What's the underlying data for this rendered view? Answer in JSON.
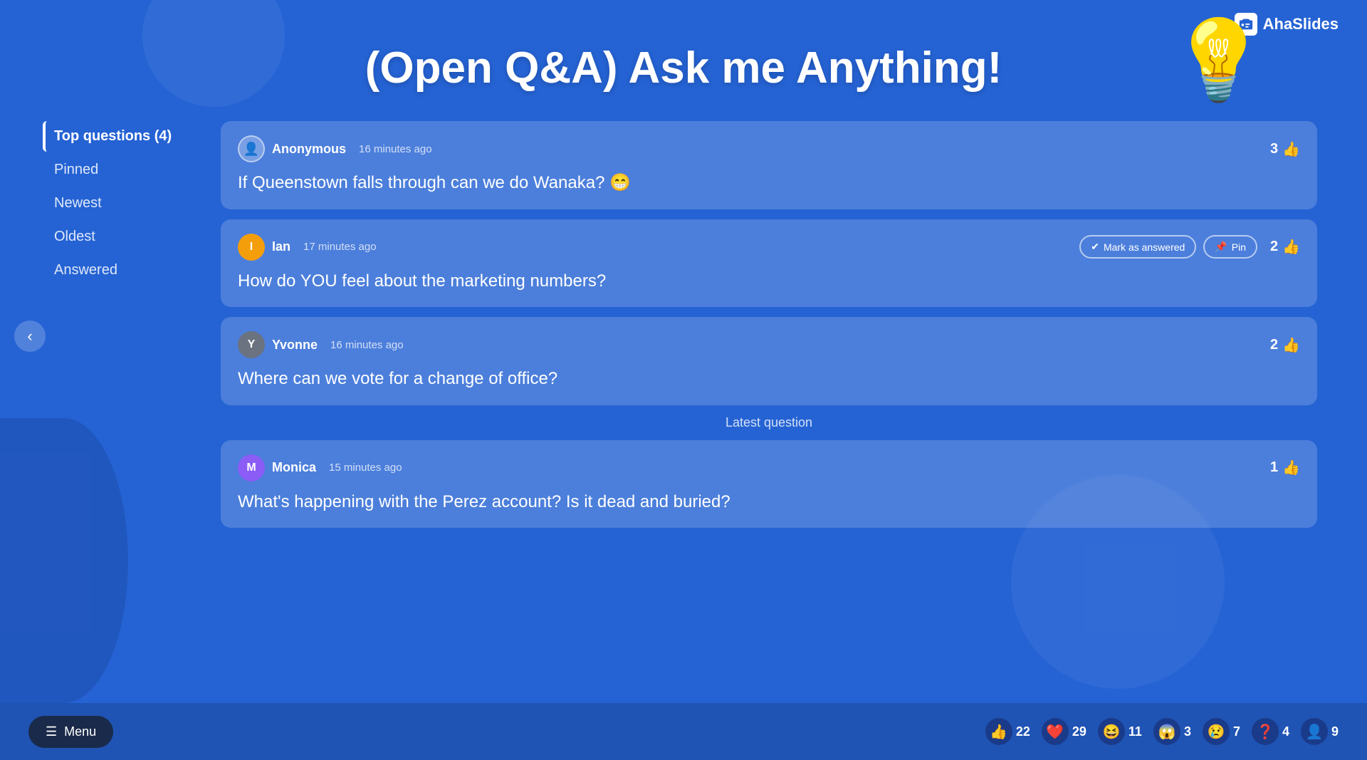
{
  "app": {
    "title": "(Open Q&A) Ask me Anything!",
    "logo_text": "AhaSlides"
  },
  "sidebar": {
    "items": [
      {
        "id": "top-questions",
        "label": "Top questions",
        "badge": "(4)",
        "active": true
      },
      {
        "id": "pinned",
        "label": "Pinned",
        "active": false
      },
      {
        "id": "newest",
        "label": "Newest",
        "active": false
      },
      {
        "id": "oldest",
        "label": "Oldest",
        "active": false
      },
      {
        "id": "answered",
        "label": "Answered",
        "active": false
      }
    ]
  },
  "questions": [
    {
      "id": "q1",
      "author": "Anonymous",
      "avatar_type": "anon",
      "avatar_letter": "",
      "time_ago": "16 minutes ago",
      "text": "If Queenstown falls through can we do Wanaka? 😁",
      "likes": 3,
      "show_actions": false
    },
    {
      "id": "q2",
      "author": "Ian",
      "avatar_type": "ian",
      "avatar_letter": "I",
      "time_ago": "17 minutes ago",
      "text": "How do YOU feel about the marketing numbers?",
      "likes": 2,
      "show_actions": true
    },
    {
      "id": "q3",
      "author": "Yvonne",
      "avatar_type": "yvonne",
      "avatar_letter": "Y",
      "time_ago": "16 minutes ago",
      "text": "Where can we vote for a change of office?",
      "likes": 2,
      "show_actions": false
    }
  ],
  "latest_question": {
    "separator": "Latest question",
    "author": "Monica",
    "avatar_type": "monica",
    "avatar_letter": "M",
    "time_ago": "15 minutes ago",
    "text": "What's happening with the Perez account? Is it dead and buried?",
    "likes": 1
  },
  "buttons": {
    "mark_answered": "Mark as answered",
    "pin": "Pin",
    "menu": "Menu"
  },
  "reactions": [
    {
      "icon": "👍",
      "count": "22",
      "bg": "#1a3a8a"
    },
    {
      "icon": "❤️",
      "count": "29",
      "bg": "#1a3a8a"
    },
    {
      "icon": "😆",
      "count": "11",
      "bg": "#1a3a8a"
    },
    {
      "icon": "😱",
      "count": "3",
      "bg": "#1a3a8a"
    },
    {
      "icon": "😢",
      "count": "7",
      "bg": "#1a3a8a"
    },
    {
      "icon": "❓",
      "count": "4",
      "bg": "#1a3a8a"
    },
    {
      "icon": "👤",
      "count": "9",
      "bg": "#1a3a8a"
    }
  ],
  "colors": {
    "bg_primary": "#2563d4",
    "card_bg": "rgba(255,255,255,0.18)",
    "sidebar_active": "#ffffff"
  }
}
